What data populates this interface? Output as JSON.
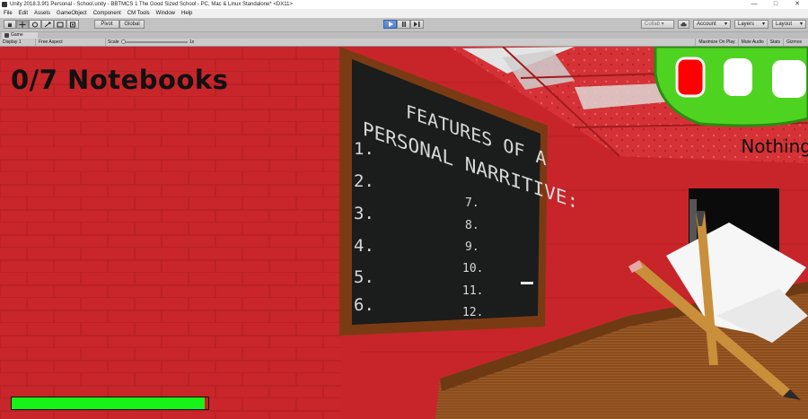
{
  "window": {
    "title": "Unity 2018.3.9f1 Personal - School.unity - BBTMCS 1 The Good Sized School - PC, Mac & Linux Standalone* <DX11>",
    "minimize": "—",
    "maximize": "□",
    "close": "✕"
  },
  "menu": [
    "File",
    "Edit",
    "Assets",
    "GameObject",
    "Component",
    "CM Tools",
    "Window",
    "Help"
  ],
  "toolbar": {
    "tools": [
      "hand-icon",
      "move-icon",
      "rotate-icon",
      "scale-icon",
      "rect-icon",
      "transform-icon"
    ],
    "pivot_label": "Pivot",
    "global_label": "Global",
    "collab_label": "Collab ▾",
    "account_label": "Account",
    "layers_label": "Layers",
    "layout_label": "Layout"
  },
  "game_tab": {
    "label": "Game"
  },
  "game_bar": {
    "display": "Display 1",
    "aspect": "Free Aspect",
    "scale_label": "Scale",
    "scale_value": "1x",
    "maximize_on_play": "Maximize On Play",
    "mute_audio": "Mute Audio",
    "stats": "Stats",
    "gizmos": "Gizmos"
  },
  "hud": {
    "notebooks": "0/7 Notebooks",
    "item_name": "Nothing",
    "stamina_fraction": 0.98,
    "item_slots": [
      {
        "state": "selected"
      },
      {
        "state": "empty"
      },
      {
        "state": "empty"
      }
    ]
  },
  "chalkboard": {
    "heading_line1": "FEATURES OF A",
    "heading_line2": "PERSONAL NARRITIVE:",
    "left_numbers": [
      "1.",
      "2.",
      "3.",
      "4.",
      "5.",
      "6."
    ],
    "right_numbers": [
      "7.",
      "8.",
      "9.",
      "10.",
      "11.",
      "12."
    ]
  },
  "colors": {
    "wall": "#c8262a",
    "stamina_fill": "#17f317",
    "stamina_empty": "#cf1d1d",
    "item_bar": "#4fd321",
    "selected_slot": "#ff0000",
    "play_button": "#5183cf"
  }
}
